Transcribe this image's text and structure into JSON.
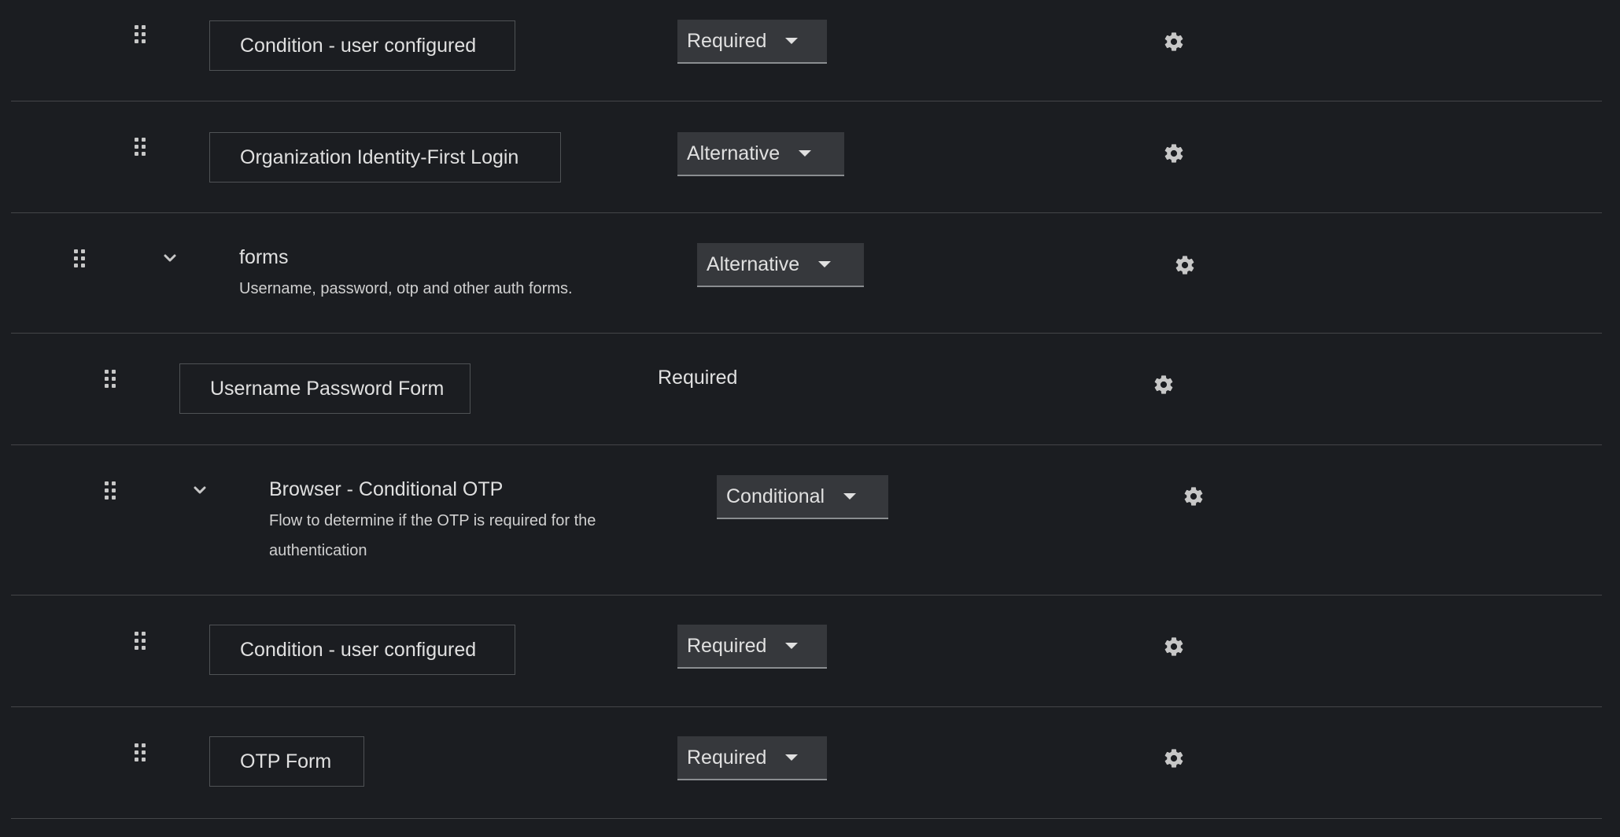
{
  "rows": [
    {
      "name": "Condition - user configured",
      "requirement": "Required"
    },
    {
      "name": "Organization Identity-First Login",
      "requirement": "Alternative"
    },
    {
      "name": "forms",
      "description": "Username, password, otp and other auth forms.",
      "requirement": "Alternative"
    },
    {
      "name": "Username Password Form",
      "requirement": "Required"
    },
    {
      "name": "Browser - Conditional OTP",
      "description_line1": "Flow to determine if the OTP is required for the",
      "description_line2": "authentication",
      "requirement": "Conditional"
    },
    {
      "name": "Condition - user configured",
      "requirement": "Required"
    },
    {
      "name": "OTP Form",
      "requirement": "Required"
    }
  ],
  "icons": {
    "drag": "drag-handle-icon",
    "expand": "chevron-down-icon",
    "settings": "gear-icon"
  },
  "colors": {
    "background": "#1b1d21",
    "select_background": "#36383c",
    "divider": "#444548",
    "text": "#e0e0e0",
    "icon": "#c7c7c7"
  }
}
